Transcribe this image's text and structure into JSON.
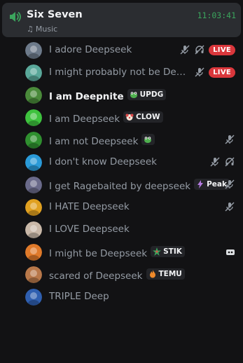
{
  "channel": {
    "name": "Six Seven",
    "status": "Music",
    "time": "11:03:41",
    "accent": "#3ba55d"
  },
  "users": [
    {
      "name": "I adore Deepseek",
      "icons": [
        "mute-icon",
        "deafen-icon"
      ],
      "live": "LIVE",
      "avatar_color": "#6d7a8a"
    },
    {
      "name": "I might probably not be Deepseek",
      "icons": [
        "mute-icon"
      ],
      "live": "LIVE",
      "avatar_color": "#5aa89a"
    },
    {
      "name": "I am Deepnite",
      "tag": "UPDG",
      "tag_icon": "frog-icon",
      "avatar_color": "#4a8a3a"
    },
    {
      "name": "I am Deepseek",
      "tag": "CLOW",
      "tag_icon": "clown-icon",
      "avatar_color": "#3ec23e"
    },
    {
      "name": "I am not Deepseek",
      "tag_icon_only": "frog-icon",
      "icons": [
        "mute-icon"
      ],
      "avatar_color": "#2f8f2f"
    },
    {
      "name": "I don't know Deepseek",
      "icons": [
        "mute-icon",
        "deafen-icon"
      ],
      "avatar_color": "#2a9ad8"
    },
    {
      "name": "I get Ragebaited by deepseek",
      "tag": "Peak",
      "tag_icon": "lightning-icon",
      "icons": [
        "mute-icon"
      ],
      "avatar_color": "#6a6a8a"
    },
    {
      "name": "I HATE Deepseek",
      "icons": [
        "mute-icon"
      ],
      "avatar_color": "#e0a020"
    },
    {
      "name": "I LOVE Deepseek",
      "avatar_color": "#c9b8a8"
    },
    {
      "name": "I might be Deepseek",
      "tag": "STIK",
      "tag_icon": "star-icon",
      "icons": [
        "bot-icon"
      ],
      "avatar_color": "#e07a2a"
    },
    {
      "name": "scared of Deepseek",
      "tag": "TEMU",
      "tag_icon": "fire-icon",
      "avatar_color": "#b8784a"
    },
    {
      "name": "TRIPLE Deep",
      "avatar_color": "#2f5fb0"
    }
  ]
}
